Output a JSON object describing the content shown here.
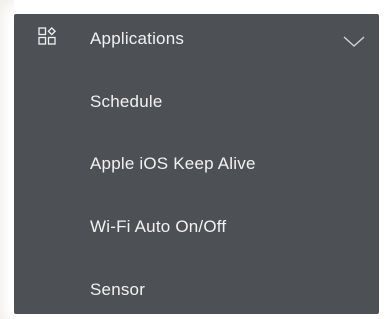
{
  "menu": {
    "header": {
      "label": "Applications",
      "icon": "applications-grid-icon",
      "expand_icon": "chevron-down-icon"
    },
    "items": [
      {
        "label": "Schedule"
      },
      {
        "label": "Apple iOS Keep Alive"
      },
      {
        "label": "Wi-Fi Auto On/Off"
      },
      {
        "label": "Sensor"
      }
    ],
    "colors": {
      "background": "#4d5055",
      "text": "#f2f2f2"
    }
  }
}
